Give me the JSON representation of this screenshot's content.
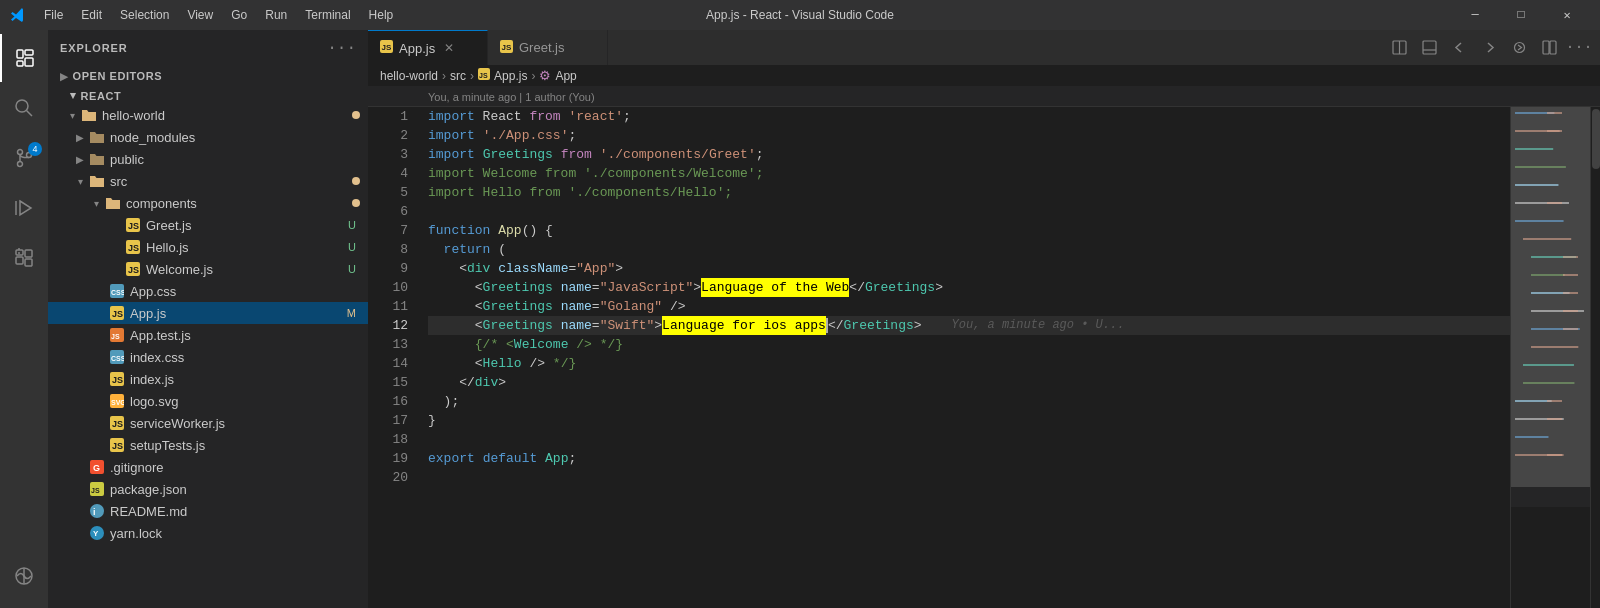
{
  "titlebar": {
    "title": "App.js - React - Visual Studio Code",
    "menu_items": [
      "File",
      "Edit",
      "Selection",
      "View",
      "Go",
      "Run",
      "Terminal",
      "Help"
    ],
    "controls": [
      "─",
      "□",
      "✕"
    ]
  },
  "activity_bar": {
    "icons": [
      {
        "name": "explorer-icon",
        "symbol": "⎘",
        "active": true
      },
      {
        "name": "search-icon",
        "symbol": "🔍",
        "active": false
      },
      {
        "name": "source-control-icon",
        "symbol": "⎇",
        "active": false,
        "badge": "4"
      },
      {
        "name": "run-icon",
        "symbol": "▷",
        "active": false
      },
      {
        "name": "extensions-icon",
        "symbol": "⊞",
        "active": false
      },
      {
        "name": "remote-icon",
        "symbol": "⊙",
        "active": false,
        "bottom": true
      }
    ]
  },
  "sidebar": {
    "header": "EXPLORER",
    "open_editors_label": "OPEN EDITORS",
    "react_label": "REACT",
    "file_tree": {
      "items": [
        {
          "id": "hello-world",
          "label": "hello-world",
          "type": "folder",
          "indent": 1,
          "expanded": true,
          "dot": true
        },
        {
          "id": "node_modules",
          "label": "node_modules",
          "type": "folder",
          "indent": 2,
          "expanded": false
        },
        {
          "id": "public",
          "label": "public",
          "type": "folder",
          "indent": 2,
          "expanded": false
        },
        {
          "id": "src",
          "label": "src",
          "type": "folder",
          "indent": 2,
          "expanded": true,
          "dot": true
        },
        {
          "id": "components",
          "label": "components",
          "type": "folder",
          "indent": 3,
          "expanded": true,
          "dot": true
        },
        {
          "id": "greet-js",
          "label": "Greet.js",
          "type": "js",
          "indent": 4,
          "badge": "U"
        },
        {
          "id": "hello-js",
          "label": "Hello.js",
          "type": "js",
          "indent": 4,
          "badge": "U"
        },
        {
          "id": "welcome-js",
          "label": "Welcome.js",
          "type": "js",
          "indent": 4,
          "badge": "U"
        },
        {
          "id": "app-css",
          "label": "App.css",
          "type": "css",
          "indent": 3
        },
        {
          "id": "app-js",
          "label": "App.js",
          "type": "js",
          "indent": 3,
          "active": true,
          "badge": "M"
        },
        {
          "id": "app-test-js",
          "label": "App.test.js",
          "type": "js",
          "indent": 3
        },
        {
          "id": "index-css",
          "label": "index.css",
          "type": "css",
          "indent": 3
        },
        {
          "id": "index-js",
          "label": "index.js",
          "type": "js",
          "indent": 3
        },
        {
          "id": "logo-svg",
          "label": "logo.svg",
          "type": "svg",
          "indent": 3
        },
        {
          "id": "service-worker",
          "label": "serviceWorker.js",
          "type": "js",
          "indent": 3
        },
        {
          "id": "setup-tests",
          "label": "setupTests.js",
          "type": "js",
          "indent": 3
        },
        {
          "id": "gitignore",
          "label": ".gitignore",
          "type": "gitignore",
          "indent": 2
        },
        {
          "id": "package-json",
          "label": "package.json",
          "type": "json",
          "indent": 2
        },
        {
          "id": "readme",
          "label": "README.md",
          "type": "md",
          "indent": 2
        },
        {
          "id": "yarn-lock",
          "label": "yarn.lock",
          "type": "yarn",
          "indent": 2
        }
      ]
    }
  },
  "tabs": [
    {
      "label": "App.js",
      "icon": "js",
      "active": true,
      "closable": true
    },
    {
      "label": "Greet.js",
      "icon": "js",
      "active": false,
      "closable": false
    }
  ],
  "breadcrumb": {
    "parts": [
      "hello-world",
      ">",
      "src",
      ">",
      "App.js",
      ">",
      "App"
    ]
  },
  "blame": "You, a minute ago  |  1 author (You)",
  "code": {
    "lines": [
      {
        "num": 1,
        "tokens": [
          {
            "t": "kw",
            "v": "import"
          },
          {
            "t": "plain",
            "v": " React "
          },
          {
            "t": "kw2",
            "v": "from"
          },
          {
            "t": "plain",
            "v": " "
          },
          {
            "t": "str",
            "v": "'react'"
          },
          {
            "t": "plain",
            "v": ";"
          }
        ]
      },
      {
        "num": 2,
        "tokens": [
          {
            "t": "kw",
            "v": "import"
          },
          {
            "t": "plain",
            "v": " "
          },
          {
            "t": "str",
            "v": "'./App.css'"
          },
          {
            "t": "plain",
            "v": ";"
          }
        ]
      },
      {
        "num": 3,
        "tokens": [
          {
            "t": "kw",
            "v": "import"
          },
          {
            "t": "plain",
            "v": " "
          },
          {
            "t": "cls",
            "v": "Greetings"
          },
          {
            "t": "plain",
            "v": " "
          },
          {
            "t": "kw2",
            "v": "from"
          },
          {
            "t": "plain",
            "v": " "
          },
          {
            "t": "str",
            "v": "'./components/Greet'"
          },
          {
            "t": "plain",
            "v": ";"
          }
        ]
      },
      {
        "num": 4,
        "tokens": [
          {
            "t": "cm",
            "v": "import Welcome from './components/Welcome';"
          }
        ]
      },
      {
        "num": 5,
        "tokens": [
          {
            "t": "cm",
            "v": "import Hello from './components/Hello';"
          }
        ]
      },
      {
        "num": 6,
        "tokens": []
      },
      {
        "num": 7,
        "tokens": [
          {
            "t": "kw",
            "v": "function"
          },
          {
            "t": "plain",
            "v": " "
          },
          {
            "t": "fn",
            "v": "App"
          },
          {
            "t": "plain",
            "v": "() {"
          }
        ]
      },
      {
        "num": 8,
        "tokens": [
          {
            "t": "plain",
            "v": "  "
          },
          {
            "t": "kw",
            "v": "return"
          },
          {
            "t": "plain",
            "v": " ("
          }
        ]
      },
      {
        "num": 9,
        "tokens": [
          {
            "t": "plain",
            "v": "    <"
          },
          {
            "t": "tag",
            "v": "div"
          },
          {
            "t": "plain",
            "v": " "
          },
          {
            "t": "attr",
            "v": "className"
          },
          {
            "t": "plain",
            "v": "="
          },
          {
            "t": "val",
            "v": "\"App\""
          },
          {
            "t": "plain",
            "v": ">"
          }
        ]
      },
      {
        "num": 10,
        "tokens": [
          {
            "t": "plain",
            "v": "      <"
          },
          {
            "t": "tag",
            "v": "Greetings"
          },
          {
            "t": "plain",
            "v": " "
          },
          {
            "t": "attr",
            "v": "name"
          },
          {
            "t": "plain",
            "v": "="
          },
          {
            "t": "val",
            "v": "\"JavaScript\""
          },
          {
            "t": "plain",
            "v": ">"
          },
          {
            "t": "hl",
            "v": "Language of the Web"
          },
          {
            "t": "plain",
            "v": "</"
          },
          {
            "t": "tag",
            "v": "Greetings"
          },
          {
            "t": "plain",
            "v": ">"
          }
        ]
      },
      {
        "num": 11,
        "tokens": [
          {
            "t": "plain",
            "v": "      <"
          },
          {
            "t": "tag",
            "v": "Greetings"
          },
          {
            "t": "plain",
            "v": " "
          },
          {
            "t": "attr",
            "v": "name"
          },
          {
            "t": "plain",
            "v": "="
          },
          {
            "t": "val",
            "v": "\"Golang\""
          },
          {
            "t": "plain",
            "v": " />"
          }
        ]
      },
      {
        "num": 12,
        "tokens": [
          {
            "t": "plain",
            "v": "      <"
          },
          {
            "t": "tag",
            "v": "Greetings"
          },
          {
            "t": "plain",
            "v": " "
          },
          {
            "t": "attr",
            "v": "name"
          },
          {
            "t": "plain",
            "v": "="
          },
          {
            "t": "val",
            "v": "\"Swift\""
          },
          {
            "t": "plain",
            "v": ">"
          },
          {
            "t": "hl",
            "v": "Language for ios apps"
          },
          {
            "t": "cursor",
            "v": ""
          },
          {
            "t": "plain",
            "v": "</"
          },
          {
            "t": "tag",
            "v": "Greetings"
          },
          {
            "t": "plain",
            "v": ">"
          }
        ],
        "ghost": "You, a minute ago • U..."
      },
      {
        "num": 13,
        "tokens": [
          {
            "t": "plain",
            "v": "      {/* <"
          },
          {
            "t": "tag",
            "v": "Welcome"
          },
          {
            "t": "plain",
            "v": " /> */}"
          }
        ]
      },
      {
        "num": 14,
        "tokens": [
          {
            "t": "plain",
            "v": "      <"
          },
          {
            "t": "tag",
            "v": "Hello"
          },
          {
            "t": "plain",
            "v": " /> */}"
          }
        ]
      },
      {
        "num": 15,
        "tokens": [
          {
            "t": "plain",
            "v": "    </"
          },
          {
            "t": "tag",
            "v": "div"
          },
          {
            "t": "plain",
            "v": ">"
          }
        ]
      },
      {
        "num": 16,
        "tokens": [
          {
            "t": "plain",
            "v": "  );"
          }
        ]
      },
      {
        "num": 17,
        "tokens": [
          {
            "t": "plain",
            "v": "}"
          }
        ]
      },
      {
        "num": 18,
        "tokens": []
      },
      {
        "num": 19,
        "tokens": [
          {
            "t": "kw",
            "v": "export"
          },
          {
            "t": "plain",
            "v": " "
          },
          {
            "t": "kw",
            "v": "default"
          },
          {
            "t": "plain",
            "v": " "
          },
          {
            "t": "cls",
            "v": "App"
          },
          {
            "t": "plain",
            "v": ";"
          }
        ]
      },
      {
        "num": 20,
        "tokens": []
      }
    ]
  },
  "icons": {
    "folder": "▸",
    "folder_open": "▾",
    "js_color": "#e8c44a",
    "css_color": "#519aba",
    "json_color": "#cbcb41",
    "md_color": "#519aba",
    "svg_color": "#ffb13b",
    "yarn_color": "#2c8ebb"
  }
}
